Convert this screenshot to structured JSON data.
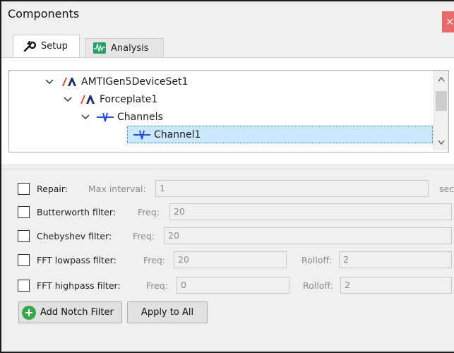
{
  "window": {
    "title": "Components",
    "close_glyph": "×"
  },
  "tabs": [
    {
      "label": "Setup",
      "icon": "wrench-icon"
    },
    {
      "label": "Analysis",
      "icon": "waveform-icon"
    }
  ],
  "tree": {
    "items": [
      {
        "label": "AMTIGen5DeviceSet1",
        "icon": "amti-logo-icon",
        "expanded": true
      },
      {
        "label": "Forceplate1",
        "icon": "amti-logo-icon",
        "expanded": true
      },
      {
        "label": "Channels",
        "icon": "signal-icon",
        "expanded": true
      },
      {
        "label": "Channel1",
        "icon": "signal-icon",
        "selected": true
      }
    ]
  },
  "filters": {
    "repair": {
      "label": "Repair:",
      "sub_label": "Max interval:",
      "value": "1",
      "unit": "sec"
    },
    "butterworth": {
      "label": "Butterworth filter:",
      "sub_label": "Freq:",
      "value": "20"
    },
    "chebyshev": {
      "label": "Chebyshev filter:",
      "sub_label": "Freq:",
      "value": "20"
    },
    "fft_lowpass": {
      "label": "FFT lowpass filter:",
      "sub_label": "Freq:",
      "value": "20",
      "rolloff_label": "Rolloff:",
      "rolloff_value": "2"
    },
    "fft_highpass": {
      "label": "FFT highpass filter:",
      "sub_label": "Freq:",
      "value": "0",
      "rolloff_label": "Rolloff:",
      "rolloff_value": "2"
    }
  },
  "buttons": {
    "add_notch": "Add Notch Filter",
    "apply_all": "Apply to All"
  },
  "colors": {
    "selection": "#cce8ff",
    "close": "#e86a6a",
    "add_icon": "#3aa54a"
  }
}
